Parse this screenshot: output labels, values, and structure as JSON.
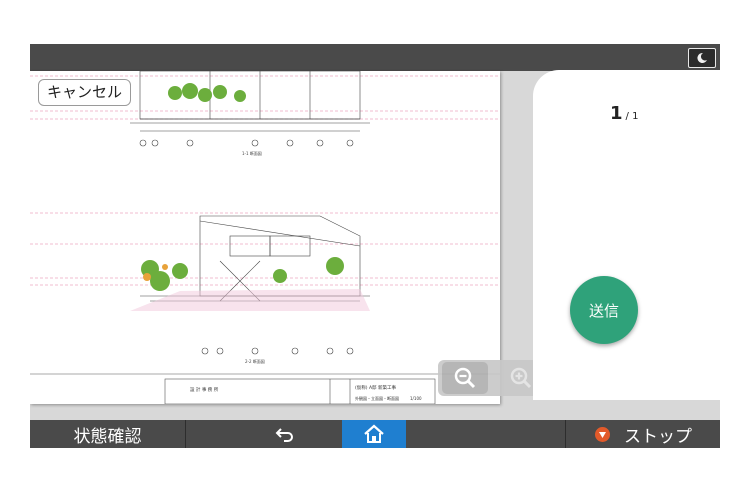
{
  "cancel_label": "キャンセル",
  "page": {
    "current": "1",
    "total": "/ 1"
  },
  "send_label": "送信",
  "bottom": {
    "status_label": "状態確認",
    "stop_label": "ストップ"
  },
  "icons": {
    "sleep": "moon-icon",
    "zoom_out": "zoom-out-icon",
    "zoom_in": "zoom-in-icon",
    "back": "back-arrow-icon",
    "home": "home-icon",
    "stop": "stop-icon"
  },
  "drawing": {
    "section1_label": "1-1 断面図",
    "section2_label": "2-2 断面図",
    "title_block_project": "(仮称) A邸 新築工事",
    "title_block_sheet": "外観図・立面図・断面図",
    "title_block_scale": "1/100",
    "title_block_office": "設 計 事 務 所"
  },
  "colors": {
    "send": "#2fa27a",
    "home": "#1f7fd0",
    "stop": "#e25a2a",
    "bar": "#4a4a4a"
  }
}
